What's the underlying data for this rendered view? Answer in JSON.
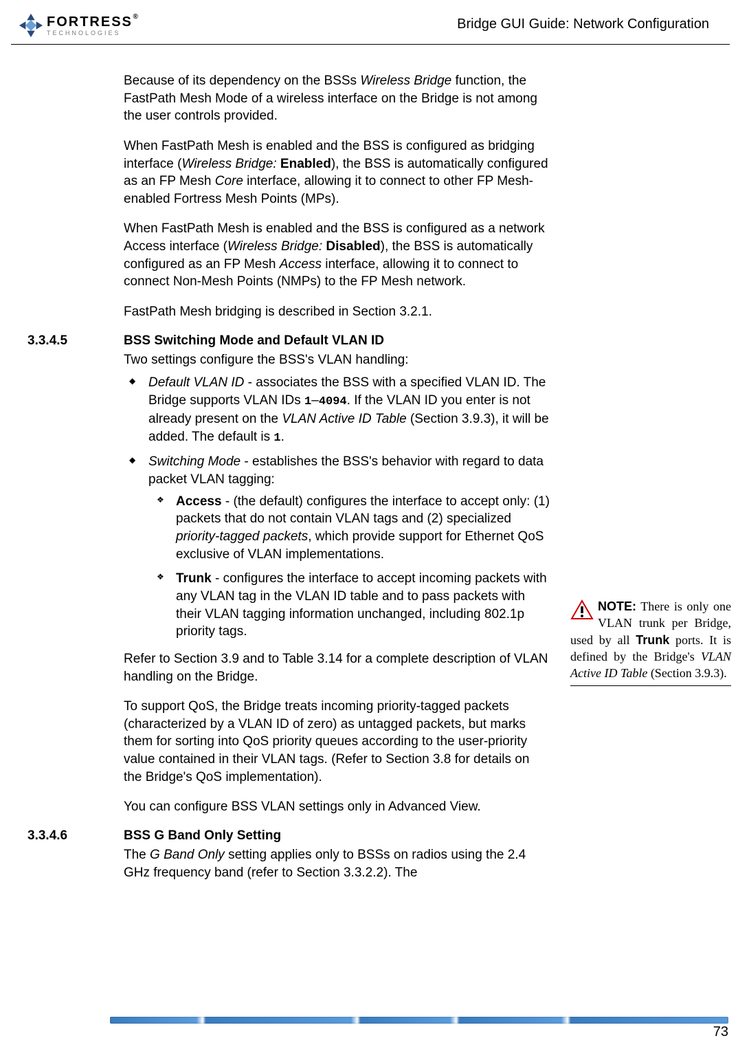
{
  "header": {
    "logo_main": "FORTRESS",
    "logo_reg": "®",
    "logo_sub": "TECHNOLOGIES",
    "title": "Bridge GUI Guide: Network Configuration"
  },
  "body": {
    "p1_a": "Because of its dependency on the BSSs ",
    "p1_b": "Wireless Bridge",
    "p1_c": " function, the FastPath Mesh Mode of a wireless interface on the Bridge is not among the user controls provided.",
    "p2_a": "When FastPath Mesh is enabled and the BSS is configured as bridging interface (",
    "p2_b": "Wireless Bridge:",
    "p2_c": " Enabled",
    "p2_d": "), the BSS is automatically configured as an FP Mesh ",
    "p2_e": "Core",
    "p2_f": " interface, allowing it to connect to other FP Mesh-enabled Fortress Mesh Points (MPs).",
    "p3_a": "When FastPath Mesh is enabled and the BSS is configured as a network Access interface (",
    "p3_b": "Wireless Bridge:",
    "p3_c": " Disabled",
    "p3_d": "), the BSS is automatically configured as an FP Mesh ",
    "p3_e": "Access",
    "p3_f": " interface, allowing it to connect to connect Non-Mesh Points (NMPs) to the FP Mesh network.",
    "p4": "FastPath Mesh bridging is described in Section 3.2.1.",
    "sec1_num": "3.3.4.5",
    "sec1_title": "BSS Switching Mode and Default VLAN ID",
    "p5": "Two settings configure the BSS's VLAN handling:",
    "li1_a": "Default VLAN ID",
    "li1_b": " - associates the BSS with a specified VLAN ID. The Bridge supports VLAN IDs ",
    "li1_c": "1",
    "li1_d": "–",
    "li1_e": "4094",
    "li1_f": ". If the VLAN ID you enter is not already present on the ",
    "li1_g": "VLAN Active ID Table",
    "li1_h": " (Section 3.9.3), it will be added. The default is ",
    "li1_i": "1",
    "li1_j": ".",
    "li2_a": "Switching Mode",
    "li2_b": " - establishes the BSS's behavior with regard to data packet VLAN tagging:",
    "sli1_a": "Access",
    "sli1_b": " - (the default) configures the interface to accept only: (1) packets that do not contain VLAN tags and (2) specialized ",
    "sli1_c": "priority-tagged packets",
    "sli1_d": ", which provide support for Ethernet QoS exclusive of VLAN implementations.",
    "sli2_a": "Trunk",
    "sli2_b": " - configures the interface to accept incoming packets with any VLAN tag in the VLAN ID table and to pass packets with their VLAN tagging information unchanged, including 802.1p priority tags.",
    "p6": "Refer to Section 3.9 and to Table 3.14 for a complete description of VLAN handling on the Bridge.",
    "p7": "To support QoS, the Bridge treats incoming priority-tagged packets (characterized by a VLAN ID of zero) as untagged packets, but marks them for sorting into QoS priority queues according to the user-priority value contained in their VLAN tags. (Refer to Section 3.8 for details on the Bridge's QoS implementation).",
    "p8": "You can configure BSS VLAN settings only in Advanced View.",
    "sec2_num": "3.3.4.6",
    "sec2_title": "BSS G Band Only Setting",
    "p9_a": "The ",
    "p9_b": "G Band Only",
    "p9_c": " setting applies only to BSSs on radios using the 2.4 GHz frequency band (refer to Section 3.3.2.2). The"
  },
  "sidenote": {
    "label": "NOTE:",
    "text_a": " There is only one VLAN trunk per Bridge, used by all ",
    "text_b": "Trunk",
    "text_c": " ports. It is defined by the Bridge's ",
    "text_d": "VLAN Active ID Table",
    "text_e": " (Section 3.9.3)."
  },
  "footer": {
    "page_num": "73"
  }
}
